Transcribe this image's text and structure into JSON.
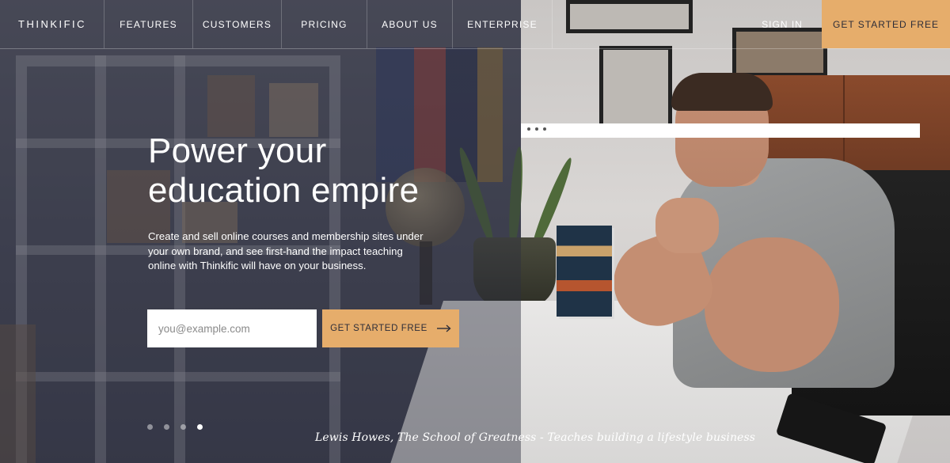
{
  "nav": {
    "logo": "THINKIFIC",
    "items": [
      "FEATURES",
      "CUSTOMERS",
      "PRICING",
      "ABOUT US",
      "ENTERPRISE"
    ],
    "sign_in": "SIGN IN",
    "cta": "GET STARTED FREE"
  },
  "hero": {
    "headline_line1": "Power your",
    "headline_line2": "education empire",
    "subtext": "Create and sell online courses and membership sites under your own brand, and see first-hand the impact teaching online with Thinkific will have on your business.",
    "email_placeholder": "you@example.com",
    "cta": "GET STARTED FREE",
    "caption": "Lewis Howes, The School of Greatness - Teaches building a lifestyle business",
    "slides_total": 4,
    "slide_active": 4
  },
  "colors": {
    "accent": "#e6ad6b",
    "nav_text": "#ffffff",
    "overlay": "#3f4150"
  }
}
